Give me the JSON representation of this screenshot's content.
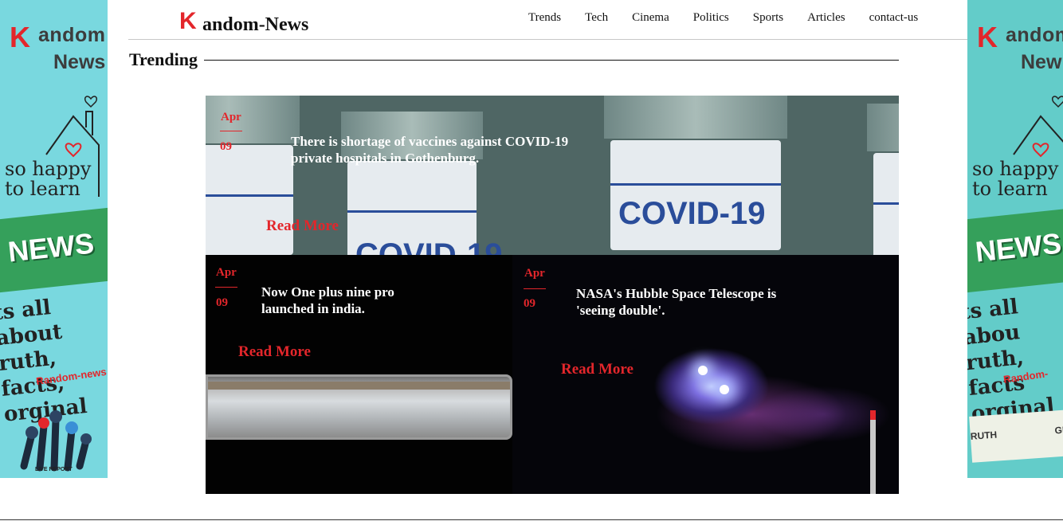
{
  "site": {
    "brand_mark": "K",
    "brand_name": "andom-News"
  },
  "nav": {
    "items": [
      "Trends",
      "Tech",
      "Cinema",
      "Politics",
      "Sports",
      "Articles",
      "contact-us"
    ]
  },
  "section": {
    "title": "Trending"
  },
  "ads": {
    "left": {
      "logo_line1": "andom",
      "logo_line2": "News",
      "happy_line1": "so happy",
      "happy_line2": "to learn",
      "news_word": "NEWS",
      "tag_line1": "ts all about",
      "tag_line2": "ruth, facts,",
      "tag_line3": "orginal",
      "brand": "Random-news",
      "live": "LIVE REPORT"
    },
    "right": {
      "logo_line1": "andom",
      "logo_line2": "New",
      "happy_line1": "so happy",
      "happy_line2": "to learn",
      "news_word": "NEWS",
      "tag_line1": "ts all abou",
      "tag_line2": "ruth, facts",
      "tag_line3": "orginal",
      "brand": "Random-",
      "truth_left": "RUTH",
      "truth_right": "GR"
    }
  },
  "articles": [
    {
      "month": "Apr",
      "day": "09",
      "headline": "There is shortage of vaccines against COVID-19 private hospitals in Gothenburg.",
      "read_more": "Read More",
      "image_text": "COVID-19"
    },
    {
      "month": "Apr",
      "day": "09",
      "headline": "Now One plus nine pro launched in india.",
      "read_more": "Read More"
    },
    {
      "month": "Apr",
      "day": "09",
      "headline": "NASA's Hubble Space Telescope is 'seeing double'.",
      "read_more": "Read More"
    }
  ],
  "colors": {
    "accent": "#e3262b",
    "ad_left_bg": "#79d8df",
    "ad_right_bg": "#63ccc9"
  }
}
